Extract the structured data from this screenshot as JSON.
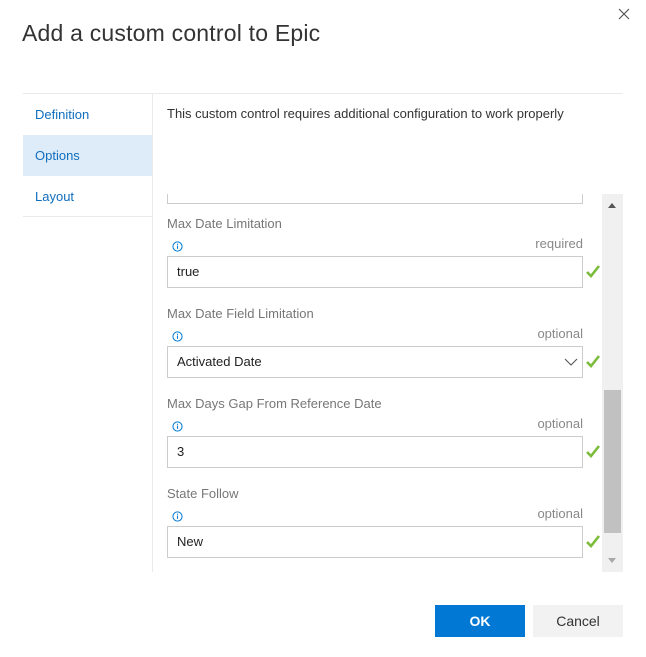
{
  "dialog": {
    "title": "Add a custom control to Epic",
    "close_icon": "close-icon"
  },
  "nav": {
    "items": [
      {
        "label": "Definition",
        "active": false
      },
      {
        "label": "Options",
        "active": true
      },
      {
        "label": "Layout",
        "active": false
      }
    ]
  },
  "content": {
    "description": "This custom control requires additional configuration to work properly",
    "fields": [
      {
        "label": "Max Date Limitation",
        "requirement": "required",
        "value": "true",
        "type": "text",
        "valid": true
      },
      {
        "label": "Max Date Field Limitation",
        "requirement": "optional",
        "value": "Activated Date",
        "type": "dropdown",
        "valid": true
      },
      {
        "label": "Max Days Gap From Reference Date",
        "requirement": "optional",
        "value": "3",
        "type": "text",
        "valid": true
      },
      {
        "label": "State Follow",
        "requirement": "optional",
        "value": "New",
        "type": "text",
        "valid": true
      }
    ]
  },
  "scrollbar": {
    "thumb_start_fraction": 0.52,
    "thumb_size_fraction": 0.42
  },
  "buttons": {
    "ok": "OK",
    "cancel": "Cancel"
  },
  "colors": {
    "accent": "#0078d4",
    "nav_link": "#106ebe",
    "nav_active_bg": "#deecf9",
    "valid_check": "#7cbb3b",
    "info_icon": "#0078d4"
  }
}
